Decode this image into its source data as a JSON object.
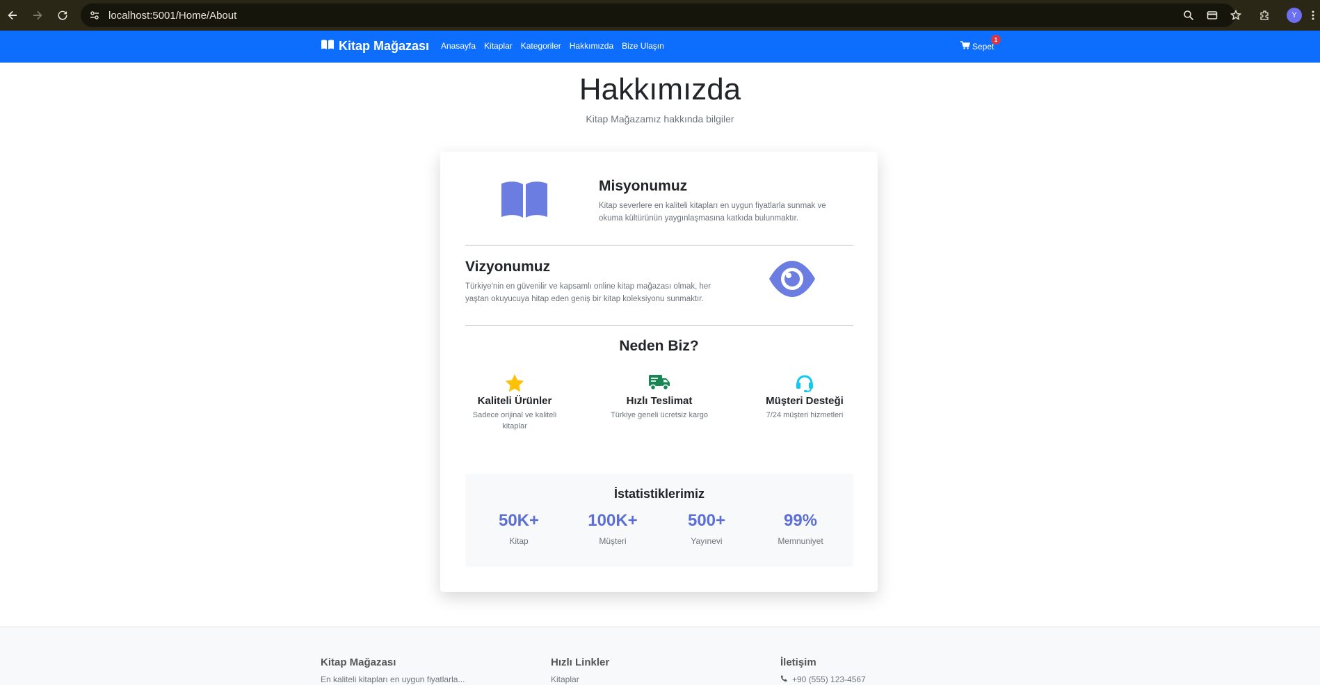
{
  "browser": {
    "url": "localhost:5001/Home/About",
    "profile_initial": "Y"
  },
  "navbar": {
    "brand": "Kitap Mağazası",
    "links": [
      "Anasayfa",
      "Kitaplar",
      "Kategoriler",
      "Hakkımızda",
      "Bize Ulaşın"
    ],
    "cart_label": "Sepet",
    "cart_count": "1",
    "color": "#0d6efd"
  },
  "header": {
    "title": "Hakkımızda",
    "subtitle": "Kitap Mağazamız hakkında bilgiler"
  },
  "mission": {
    "title": "Misyonumuz",
    "text": "Kitap severlere en kaliteli kitapları en uygun fiyatlarla sunmak ve okuma kültürünün yaygınlaşmasına katkıda bulunmaktır.",
    "icon": "book-open-icon"
  },
  "vision": {
    "title": "Vizyonumuz",
    "text": "Türkiye'nin en güvenilir ve kapsamlı online kitap mağazası olmak, her yaştan okuyucuya hitap eden geniş bir kitap koleksiyonu sunmaktır.",
    "icon": "eye-icon"
  },
  "why_us": {
    "title": "Neden Biz?",
    "features": [
      {
        "title": "Kaliteli Ürünler",
        "text": "Sadece orijinal ve kaliteli kitaplar",
        "icon": "star-icon",
        "color": "#ffc107"
      },
      {
        "title": "Hızlı Teslimat",
        "text": "Türkiye geneli ücretsiz kargo",
        "icon": "truck-icon",
        "color": "#198754"
      },
      {
        "title": "Müşteri Desteği",
        "text": "7/24 müşteri hizmetleri",
        "icon": "headset-icon",
        "color": "#0dcaf0"
      }
    ]
  },
  "stats": {
    "title": "İstatistiklerimiz",
    "items": [
      {
        "value": "50K+",
        "label": "Kitap"
      },
      {
        "value": "100K+",
        "label": "Müşteri"
      },
      {
        "value": "500+",
        "label": "Yayınevi"
      },
      {
        "value": "99%",
        "label": "Memnuniyet"
      }
    ],
    "accent": "#5b6fd6"
  },
  "footer": {
    "columns": [
      {
        "heading": "Kitap Mağazası",
        "line": "En kaliteli kitapları en uygun fiyatlarla..."
      },
      {
        "heading": "Hızlı Linkler",
        "line": "Kitaplar"
      },
      {
        "heading": "İletişim",
        "line": "+90 (555) 123-4567"
      }
    ]
  }
}
